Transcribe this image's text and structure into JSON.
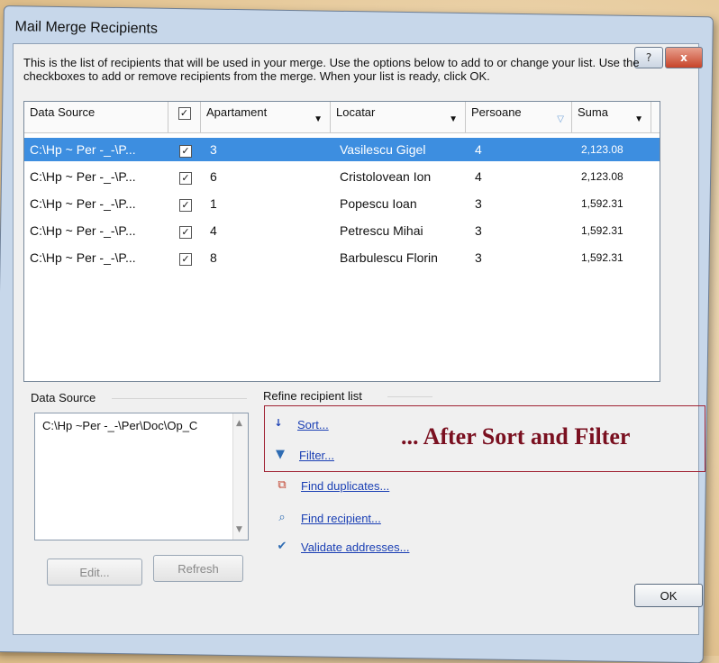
{
  "window": {
    "title": "Mail Merge Recipients",
    "help_label": "?",
    "close_label": "x"
  },
  "instructions": "This is the list of recipients that will be used in your merge.  Use the options below to add to or change your list.  Use the checkboxes to add or remove recipients from the merge.  When your list is ready, click OK.",
  "table": {
    "headers": {
      "data_source": "Data Source",
      "check": "✓",
      "apartament": "Apartament",
      "locatar": "Locatar",
      "persoane": "Persoane",
      "suma": "Suma"
    },
    "rows": [
      {
        "source": "C:\\Hp ~ Per -_-\\P...",
        "check": "✓",
        "apartament": "3",
        "locatar": "Vasilescu Gigel",
        "persoane": "4",
        "suma": "2,123.08",
        "selected": true
      },
      {
        "source": "C:\\Hp ~ Per -_-\\P...",
        "check": "✓",
        "apartament": "6",
        "locatar": "Cristolovean Ion",
        "persoane": "4",
        "suma": "2,123.08",
        "selected": false
      },
      {
        "source": "C:\\Hp ~ Per -_-\\P...",
        "check": "✓",
        "apartament": "1",
        "locatar": "Popescu Ioan",
        "persoane": "3",
        "suma": "1,592.31",
        "selected": false
      },
      {
        "source": "C:\\Hp ~ Per -_-\\P...",
        "check": "✓",
        "apartament": "4",
        "locatar": "Petrescu Mihai",
        "persoane": "3",
        "suma": "1,592.31",
        "selected": false
      },
      {
        "source": "C:\\Hp ~ Per -_-\\P...",
        "check": "✓",
        "apartament": "8",
        "locatar": "Barbulescu Florin",
        "persoane": "3",
        "suma": "1,592.31",
        "selected": false
      }
    ]
  },
  "data_source_panel": {
    "label": "Data Source",
    "item": "C:\\Hp ~Per -_-\\Per\\Doc\\Op_C",
    "edit_label": "Edit...",
    "refresh_label": "Refresh"
  },
  "refine": {
    "label": "Refine recipient list",
    "sort": "Sort...",
    "filter": "Filter...",
    "find_duplicates": "Find duplicates...",
    "find_recipient": "Find recipient...",
    "validate": "Validate addresses..."
  },
  "callout": "... After Sort and Filter",
  "ok_label": "OK",
  "colors": {
    "selection": "#3d8ee0",
    "link": "#1a3fb4",
    "callout_text": "#7a1020",
    "callout_border": "#a02233"
  }
}
